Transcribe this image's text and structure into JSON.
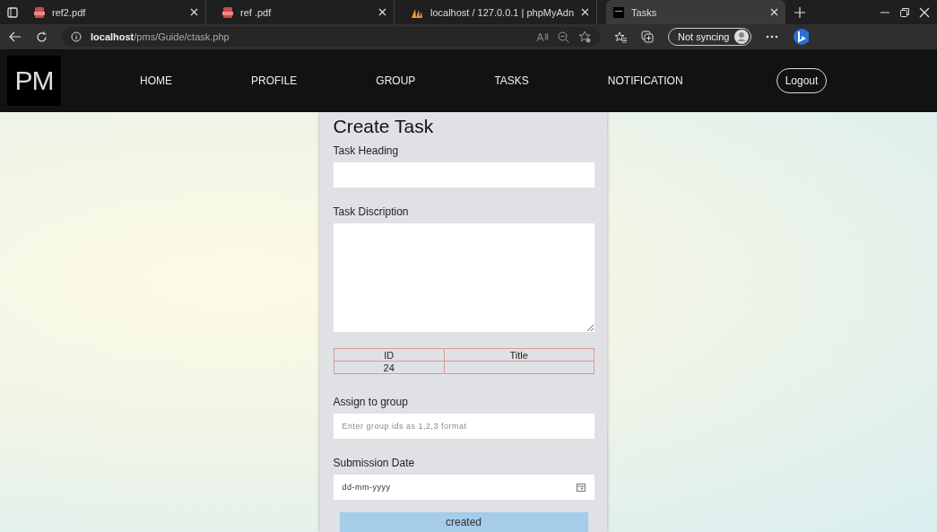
{
  "browser": {
    "tabs": [
      {
        "title": "ref2.pdf",
        "kind": "pdf",
        "selected": false
      },
      {
        "title": "ref .pdf",
        "kind": "pdf",
        "selected": false
      },
      {
        "title": "localhost / 127.0.0.1 | phpMyAdn",
        "kind": "sail",
        "selected": false
      },
      {
        "title": "Tasks",
        "kind": "pm",
        "selected": true
      }
    ],
    "address": {
      "host": "localhost",
      "path": "/pms/Guide/ctask.php"
    },
    "sync": "Not syncing"
  },
  "navbar": {
    "logo": "PM",
    "links": [
      "HOME",
      "PROFILE",
      "GROUP",
      "TASKS",
      "NOTIFICATION"
    ],
    "logout": "Logout"
  },
  "form": {
    "title": "Create Task",
    "fields": [
      {
        "kind": "text",
        "label": "Task Heading"
      },
      {
        "kind": "textarea",
        "label": "Task Discription"
      },
      {
        "kind": "table",
        "columns": [
          "ID",
          "Title"
        ],
        "rows": [
          [
            "24",
            ""
          ]
        ]
      },
      {
        "kind": "text",
        "label": "Assign to group",
        "placeholder": "Enter group ids as 1,2,3 format"
      },
      {
        "kind": "date",
        "label": "Submission Date",
        "placeholder": "dd-mm-yyyy"
      }
    ],
    "button": "created"
  }
}
